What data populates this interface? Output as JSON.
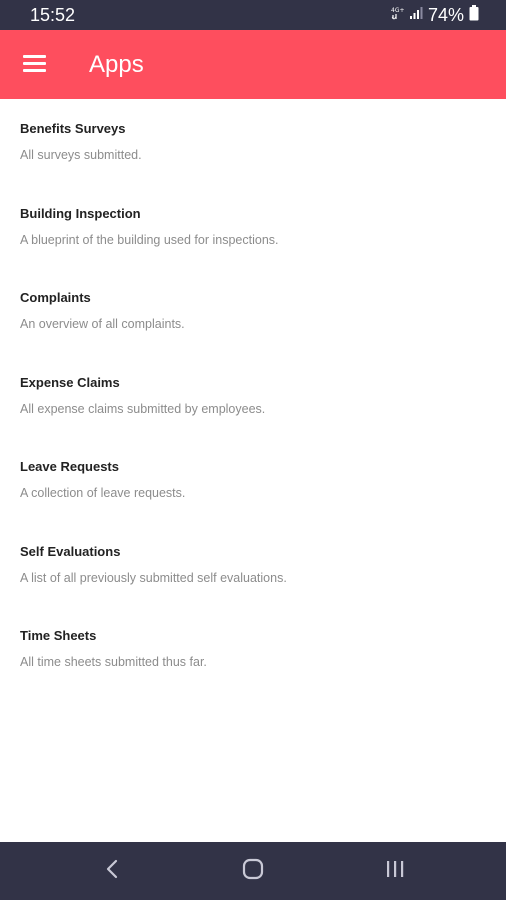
{
  "status_bar": {
    "time": "15:52",
    "network_label": "4G+",
    "battery": "74%",
    "icons": [
      "network-4g-icon",
      "signal-icon",
      "battery-icon"
    ]
  },
  "app_bar": {
    "title": "Apps",
    "menu_icon": "hamburger-menu-icon",
    "color": "#fe4e5e"
  },
  "apps": [
    {
      "title": "Benefits Surveys",
      "description": "All surveys submitted."
    },
    {
      "title": "Building Inspection",
      "description": "A blueprint of the building used for inspections."
    },
    {
      "title": "Complaints",
      "description": "An overview of all complaints."
    },
    {
      "title": "Expense Claims",
      "description": "All expense claims submitted by employees."
    },
    {
      "title": "Leave Requests",
      "description": "A collection of leave requests."
    },
    {
      "title": "Self Evaluations",
      "description": "A list of all previously submitted self evaluations."
    },
    {
      "title": "Time Sheets",
      "description": "All time sheets submitted thus far."
    }
  ],
  "nav_bar": {
    "buttons": [
      "back-icon",
      "home-icon",
      "recent-apps-icon"
    ],
    "color": "#323347"
  }
}
